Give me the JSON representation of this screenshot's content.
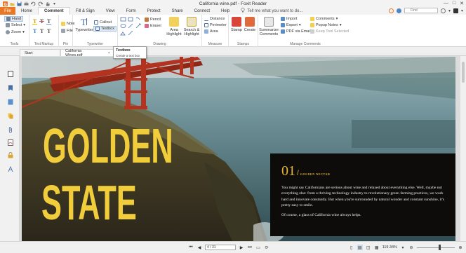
{
  "window": {
    "title": "California wine.pdf - Foxit Reader",
    "min_glyph": "—",
    "max_glyph": "□",
    "close_glyph": "✕"
  },
  "ribbon_tabs": [
    {
      "label": "File",
      "name": "tab-file"
    },
    {
      "label": "Home",
      "name": "tab-home"
    },
    {
      "label": "Comment",
      "name": "tab-comment"
    },
    {
      "label": "Fill & Sign",
      "name": "tab-fill-sign"
    },
    {
      "label": "View",
      "name": "tab-view"
    },
    {
      "label": "Form",
      "name": "tab-form"
    },
    {
      "label": "Protect",
      "name": "tab-protect"
    },
    {
      "label": "Share",
      "name": "tab-share"
    },
    {
      "label": "Connect",
      "name": "tab-connect"
    },
    {
      "label": "Help",
      "name": "tab-help"
    }
  ],
  "active_tab": "Comment",
  "tell_me": "Tell me what you want to do...",
  "find_placeholder": "Find",
  "groups": {
    "tools": {
      "label": "Tools",
      "hand": "Hand",
      "select": "Select",
      "zoom": "Zoom"
    },
    "text_markup": {
      "label": "Text Markup"
    },
    "pin": {
      "label": "Pin",
      "note": "Note",
      "file": "File"
    },
    "typewriter": {
      "label": "Typewriter",
      "typewriter": "Typewriter",
      "callout": "Callout",
      "textbox": "Textbox"
    },
    "drawing": {
      "label": "Drawing",
      "pencil": "Pencil",
      "eraser": "Eraser",
      "area_highlight": "Area Highlight",
      "search_highlight": "Search & Highlight"
    },
    "measure": {
      "label": "Measure",
      "distance": "Distance",
      "perimeter": "Perimeter",
      "area": "Area"
    },
    "stamps": {
      "label": "Stamps",
      "stamp": "Stamp",
      "create": "Create"
    },
    "manage": {
      "label": "Manage Comments",
      "summarize": "Summarize Comments",
      "import": "Import",
      "export": "Export",
      "pdf_via_email": "PDF via Email",
      "comments": "Comments",
      "popup_notes": "Popup Notes",
      "keep_tool": "Keep Tool Selected"
    }
  },
  "doc_tabs": [
    {
      "label": "Start"
    },
    {
      "label": "California Wines.pdf",
      "close": "×"
    }
  ],
  "tooltip": {
    "title": "Textbox",
    "description": "Create a text box"
  },
  "page": {
    "headline_line1": "GOLDEN",
    "headline_line2": "STATE",
    "section_number": "01",
    "section_slash": "/",
    "section_kicker": "GOLDEN NECTAR",
    "paragraph1": "You might say Californians are serious about wine and relaxed about everything else. Well, maybe not everything else: from a thriving technology industry to revolutionary green farming practices, we work hard and innovate constantly. But when you're surrounded by natural wonder and constant sunshine, it's pretty easy to smile.",
    "paragraph2": "Of course, a glass of California wine always helps."
  },
  "status": {
    "page_indicator": "4 / 31",
    "zoom": "119.34%",
    "zoom_fraction": 0.6
  },
  "colors": {
    "file_tab": "#e97826",
    "headline": "#f1cd3c",
    "panel_bg": "#0d0c0b",
    "kicker": "#e6b62f"
  }
}
